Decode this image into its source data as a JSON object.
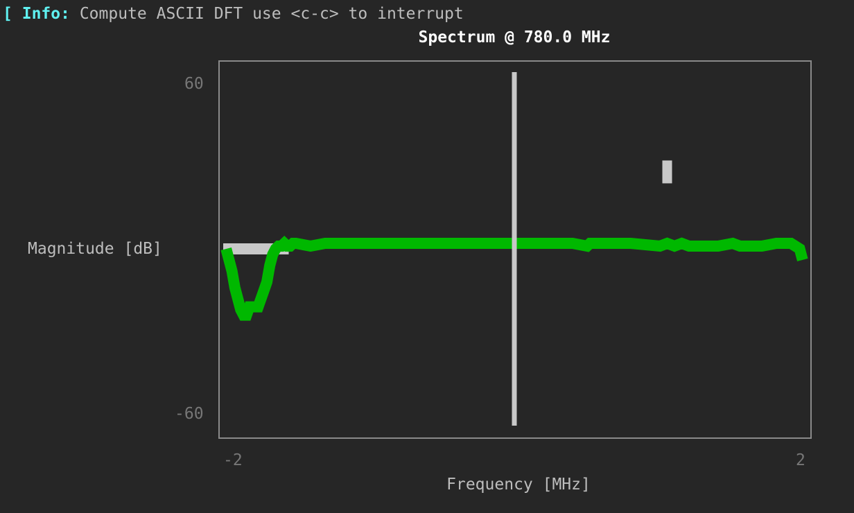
{
  "status": {
    "bracket": "[",
    "tag": "Info:",
    "message": "Compute ASCII DFT use <c-c> to interrupt"
  },
  "colors": {
    "background": "#262626",
    "info": "#5ff0f0",
    "trace": "#00b800",
    "marker": "#c8c8c8",
    "frame": "#8a8a8a",
    "tick": "#777777",
    "label": "#bdbdbd",
    "title": "#ffffff"
  },
  "chart_data": {
    "type": "line",
    "title": "Spectrum @ 780.0 MHz",
    "xlabel": "Frequency [MHz]",
    "ylabel": "Magnitude [dB]",
    "xlim": [
      -2,
      2
    ],
    "ylim": [
      -60,
      60
    ],
    "xticks": [
      "-2",
      "2"
    ],
    "yticks": [
      "60",
      "-60"
    ],
    "grid": false,
    "series": [
      {
        "x": [
          -1.98,
          -1.96,
          -1.94,
          -1.92,
          -1.9,
          -1.88,
          -1.86,
          -1.84,
          -1.82,
          -1.8,
          -1.78,
          -1.76,
          -1.74,
          -1.72,
          -1.7,
          -1.68,
          -1.66,
          -1.64,
          -1.62,
          -1.6,
          -1.58,
          -1.56,
          -1.54,
          -1.52,
          -1.5,
          -1.4,
          -1.3,
          -1.2,
          -1.1,
          -1.0,
          -0.8,
          -0.6,
          -0.4,
          -0.2,
          0.0,
          0.2,
          0.4,
          0.5,
          0.52,
          0.55,
          0.6,
          0.8,
          1.0,
          1.05,
          1.1,
          1.15,
          1.2,
          1.3,
          1.4,
          1.5,
          1.55,
          1.6,
          1.7,
          1.8,
          1.9,
          1.96,
          1.98
        ],
        "values": [
          0,
          -4,
          -8,
          -14,
          -18,
          -22,
          -24,
          -24,
          -21,
          -21,
          -21,
          -21,
          -18,
          -15,
          -12,
          -6,
          -2,
          0,
          1,
          1,
          2,
          1,
          1,
          2,
          2,
          1,
          2,
          2,
          2,
          2,
          2,
          2,
          2,
          2,
          2,
          2,
          2,
          1,
          2,
          2,
          2,
          2,
          1,
          2,
          1,
          2,
          1,
          1,
          1,
          2,
          1,
          1,
          1,
          2,
          2,
          0,
          -4
        ]
      }
    ],
    "markers": [
      {
        "type": "vertical",
        "x": 0,
        "y_range": [
          -60,
          60
        ]
      },
      {
        "type": "point",
        "x": 1.05,
        "y": 28
      },
      {
        "type": "horizontal",
        "x_range": [
          -2,
          -1.55
        ],
        "y": 0
      }
    ]
  }
}
